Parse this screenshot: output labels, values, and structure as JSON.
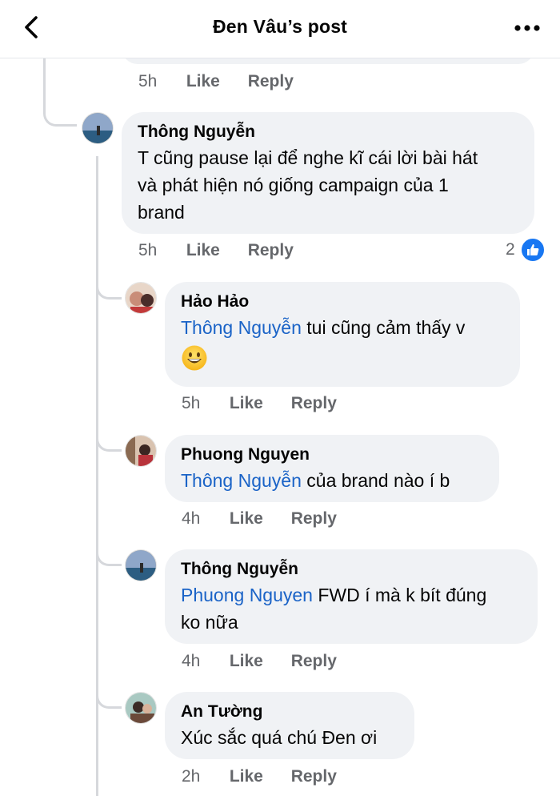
{
  "header": {
    "title": "Đen Vâu’s post"
  },
  "previous_comment": {
    "time": "5h",
    "like": "Like",
    "reply": "Reply"
  },
  "comment": {
    "author": "Thông Nguyễn",
    "text_lines": [
      "T cũng pause lại để nghe kĩ cái lời bài hát",
      "và phát hiện nó giống campaign của 1",
      "brand"
    ],
    "time": "5h",
    "like": "Like",
    "reply": "Reply",
    "reaction_count": "2"
  },
  "replies": [
    {
      "author": "Hảo Hảo",
      "mention": "Thông Nguyễn",
      "text": " tui cũng cảm thấy v",
      "time": "5h",
      "like": "Like",
      "reply": "Reply"
    },
    {
      "author": "Phuong Nguyen",
      "mention": "Thông Nguyễn",
      "text": " của brand nào í b",
      "time": "4h",
      "like": "Like",
      "reply": "Reply"
    },
    {
      "author": "Thông Nguyễn",
      "mention": "Phuong Nguyen",
      "text": " FWD í mà k bít đúng",
      "text2": "ko nữa",
      "time": "4h",
      "like": "Like",
      "reply": "Reply"
    },
    {
      "author": "An Tường",
      "text": "Xúc sắc quá chú Đen ơi",
      "time": "2h",
      "like": "Like",
      "reply": "Reply"
    }
  ],
  "colors": {
    "mention": "#1a63c7",
    "bubble": "#f0f2f5",
    "meta": "#65676b",
    "like_badge": "#1877f2"
  }
}
